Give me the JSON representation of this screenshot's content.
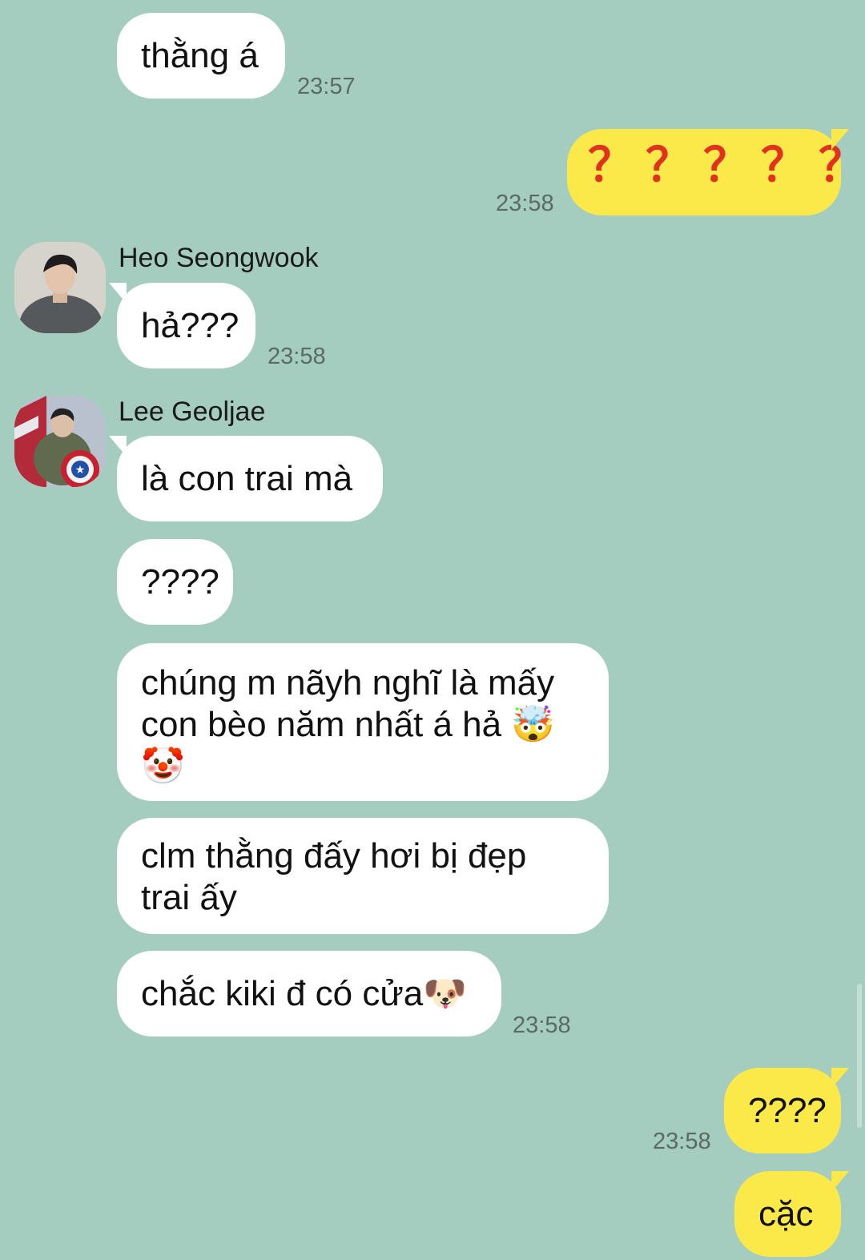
{
  "theme": {
    "background": "#a4cdc0",
    "incoming_bubble": "#ffffff",
    "outgoing_bubble": "#fbe94a",
    "question_mark_color": "#e0321f"
  },
  "messages": [
    {
      "text": "thằng á",
      "time": "23:57"
    },
    {
      "text": "？？？？？",
      "time": "23:58"
    },
    {
      "sender": "Heo Seongwook",
      "avatar_icon": "person-avatar-icon",
      "text": "hả???",
      "time": "23:58"
    },
    {
      "sender": "Lee Geoljae",
      "avatar_icon": "shield-avatar-icon",
      "text": "là con trai mà"
    },
    {
      "text": "????"
    },
    {
      "text_line1": "chúng m nãyh nghĩ là mấy",
      "text_line2": "con bèo năm nhất á hả",
      "emoji1": "🤯",
      "emoji2": "🤡"
    },
    {
      "text_line1": "clm thằng đấy hơi bị đẹp",
      "text_line2": "trai ấy"
    },
    {
      "text": "chắc kiki đ có cửa",
      "emoji": "🐶",
      "time": "23:58"
    },
    {
      "text": "????",
      "time": "23:58"
    },
    {
      "text": "cặc"
    }
  ]
}
